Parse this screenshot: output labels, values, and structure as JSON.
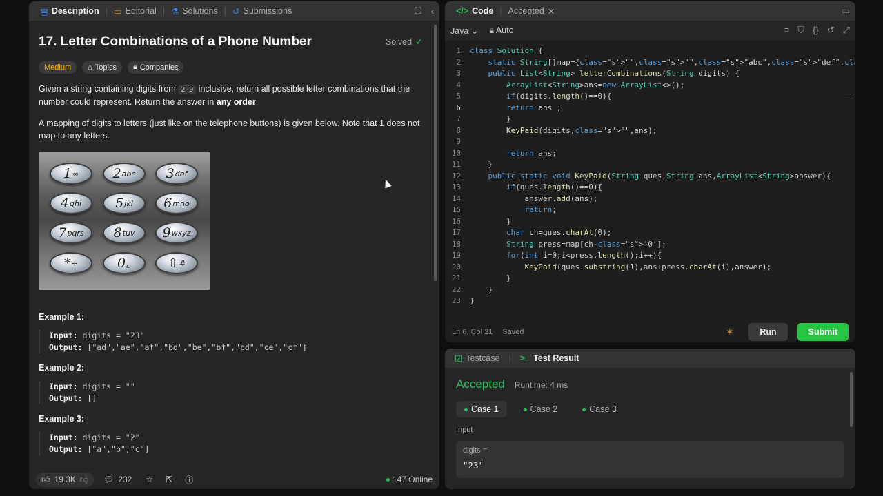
{
  "left_tabs": [
    {
      "label": "Description",
      "icon": "description-icon",
      "active": true
    },
    {
      "label": "Editorial",
      "icon": "editorial-icon",
      "active": false
    },
    {
      "label": "Solutions",
      "icon": "flask-icon",
      "active": false
    },
    {
      "label": "Submissions",
      "icon": "history-icon",
      "active": false
    }
  ],
  "problem": {
    "title": "17. Letter Combinations of a Phone Number",
    "solved_label": "Solved",
    "difficulty": "Medium",
    "topics_label": "Topics",
    "companies_label": "Companies",
    "para1_a": "Given a string containing digits from ",
    "para1_code": "2-9",
    "para1_b": " inclusive, return all possible letter combinations that the number could represent. Return the answer in ",
    "para1_bold": "any order",
    "para1_c": ".",
    "para2": "A mapping of digits to letters (just like on the telephone buttons) is given below. Note that 1 does not map to any letters."
  },
  "keypad": [
    {
      "digit": "1",
      "letters": "∞"
    },
    {
      "digit": "2",
      "letters": "abc"
    },
    {
      "digit": "3",
      "letters": "def"
    },
    {
      "digit": "4",
      "letters": "ghi"
    },
    {
      "digit": "5",
      "letters": "jkl"
    },
    {
      "digit": "6",
      "letters": "mno"
    },
    {
      "digit": "7",
      "letters": "pqrs"
    },
    {
      "digit": "8",
      "letters": "tuv"
    },
    {
      "digit": "9",
      "letters": "wxyz"
    },
    {
      "digit": "*",
      "letters": "+"
    },
    {
      "digit": "0",
      "letters": "␣"
    },
    {
      "digit": "⇧",
      "letters": "#"
    }
  ],
  "examples": [
    {
      "title": "Example 1:",
      "input_label": "Input:",
      "input": "digits = \"23\"",
      "output_label": "Output:",
      "output": "[\"ad\",\"ae\",\"af\",\"bd\",\"be\",\"bf\",\"cd\",\"ce\",\"cf\"]"
    },
    {
      "title": "Example 2:",
      "input_label": "Input:",
      "input": "digits = \"\"",
      "output_label": "Output:",
      "output": "[]"
    },
    {
      "title": "Example 3:",
      "input_label": "Input:",
      "input": "digits = \"2\"",
      "output_label": "Output:",
      "output": "[\"a\",\"b\",\"c\"]"
    }
  ],
  "left_footer": {
    "likes": "19.3K",
    "comments": "232",
    "online": "147 Online"
  },
  "code_tabs": [
    {
      "label": "Code",
      "active": true
    },
    {
      "label": "Accepted",
      "active": false
    }
  ],
  "editor": {
    "language": "Java",
    "mode": "Auto",
    "status_position": "Ln 6, Col 21",
    "status_saved": "Saved",
    "run_label": "Run",
    "submit_label": "Submit",
    "lines": [
      {
        "n": "1",
        "code": "class Solution {"
      },
      {
        "n": "2",
        "code": "    static String[]map={\"\",\"\",\"abc\",\"def\",\"ghi\",\"jkl\",\"mno\",\"pqrs\",\"tuv\",\"wxyz\"};"
      },
      {
        "n": "3",
        "code": "    public List<String> letterCombinations(String digits) {"
      },
      {
        "n": "4",
        "code": "        ArrayList<String>ans=new ArrayList<>();"
      },
      {
        "n": "5",
        "code": "        if(digits.length()==0){"
      },
      {
        "n": "6",
        "code": "        return ans ;"
      },
      {
        "n": "7",
        "code": "        }"
      },
      {
        "n": "8",
        "code": "        KeyPaid(digits,\"\",ans);"
      },
      {
        "n": "9",
        "code": ""
      },
      {
        "n": "10",
        "code": "        return ans;"
      },
      {
        "n": "11",
        "code": "    }"
      },
      {
        "n": "12",
        "code": "    public static void KeyPaid(String ques,String ans,ArrayList<String>answer){"
      },
      {
        "n": "13",
        "code": "        if(ques.length()==0){"
      },
      {
        "n": "14",
        "code": "            answer.add(ans);"
      },
      {
        "n": "15",
        "code": "            return;"
      },
      {
        "n": "16",
        "code": "        }"
      },
      {
        "n": "17",
        "code": "        char ch=ques.charAt(0);"
      },
      {
        "n": "18",
        "code": "        String press=map[ch-'0'];"
      },
      {
        "n": "19",
        "code": "        for(int i=0;i<press.length();i++){"
      },
      {
        "n": "20",
        "code": "            KeyPaid(ques.substring(1),ans+press.charAt(i),answer);"
      },
      {
        "n": "21",
        "code": "        }"
      },
      {
        "n": "22",
        "code": "    }"
      },
      {
        "n": "23",
        "code": "}"
      }
    ]
  },
  "result": {
    "tabs": [
      {
        "label": "Testcase",
        "active": false
      },
      {
        "label": "Test Result",
        "active": true
      }
    ],
    "status": "Accepted",
    "runtime": "Runtime: 4 ms",
    "cases": [
      "Case 1",
      "Case 2",
      "Case 3"
    ],
    "input_label": "Input",
    "var_name": "digits =",
    "var_value": "\"23\""
  }
}
